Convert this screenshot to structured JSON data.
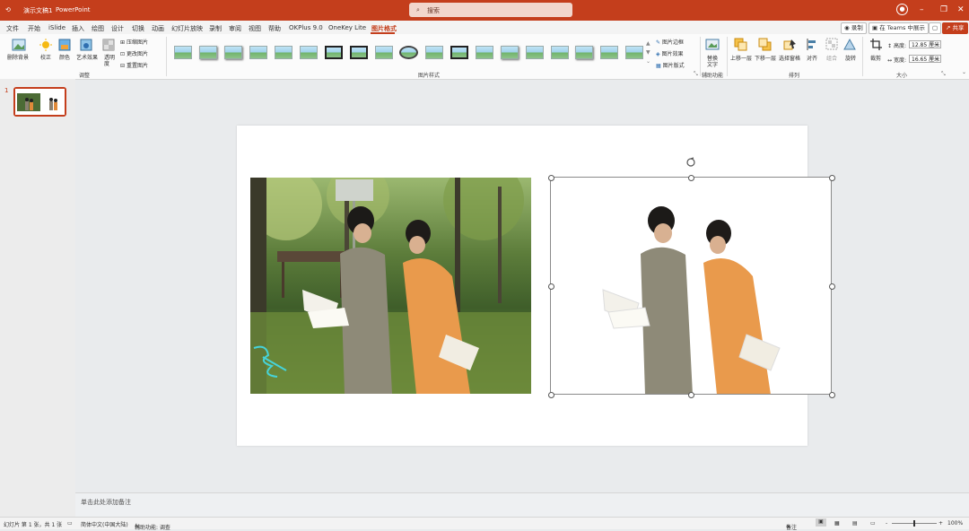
{
  "titlebar": {
    "doc_title": "演示文稿1",
    "app_name": "PowerPoint",
    "search_placeholder": "搜索",
    "minimize": "–",
    "restore": "❐",
    "close": "✕"
  },
  "menu": [
    "文件",
    "开始",
    "iSlide",
    "插入",
    "绘图",
    "设计",
    "切换",
    "动画",
    "幻灯片放映",
    "录制",
    "审阅",
    "视图",
    "帮助",
    "OKPlus 9.0",
    "OneKey Lite",
    "图片格式"
  ],
  "topright": {
    "record": "录制",
    "teams": "在 Teams 中展示",
    "share": "共享"
  },
  "ribbon": {
    "adjust": {
      "remove_bg": "删除背景",
      "corrections": "校正",
      "color": "颜色",
      "artistic": "艺术效果",
      "transparency_1": "透明",
      "transparency_2": "度",
      "compress": "压缩图片",
      "change": "更改图片",
      "reset": "重置图片",
      "group_label": "调整"
    },
    "styles": {
      "border": "图片边框",
      "effects": "图片效果",
      "layout": "图片版式",
      "group_label": "图片样式"
    },
    "accessibility": {
      "alt_text_1": "替换",
      "alt_text_2": "文字",
      "group_label": "辅助功能"
    },
    "arrange": {
      "forward": "上移一层",
      "backward": "下移一层",
      "selection_pane": "选择窗格",
      "align": "对齐",
      "group": "组合",
      "rotate": "旋转",
      "group_label": "排列"
    },
    "size": {
      "crop": "裁剪",
      "height_label": "高度:",
      "height_value": "12.85 厘米",
      "width_label": "宽度:",
      "width_value": "16.65 厘米",
      "group_label": "大小"
    }
  },
  "slides_panel": {
    "slide_number": "1"
  },
  "notes": {
    "placeholder": "单击此处添加备注"
  },
  "statusbar": {
    "slide_info": "幻灯片 第 1 张，共 1 张",
    "language": "简体中文(中国大陆)",
    "accessibility": "辅助功能: 调查",
    "notes_btn": "备注",
    "zoom_minus": "-",
    "zoom_plus": "+",
    "zoom": "100%"
  },
  "colors": {
    "accent": "#c43e1c"
  }
}
